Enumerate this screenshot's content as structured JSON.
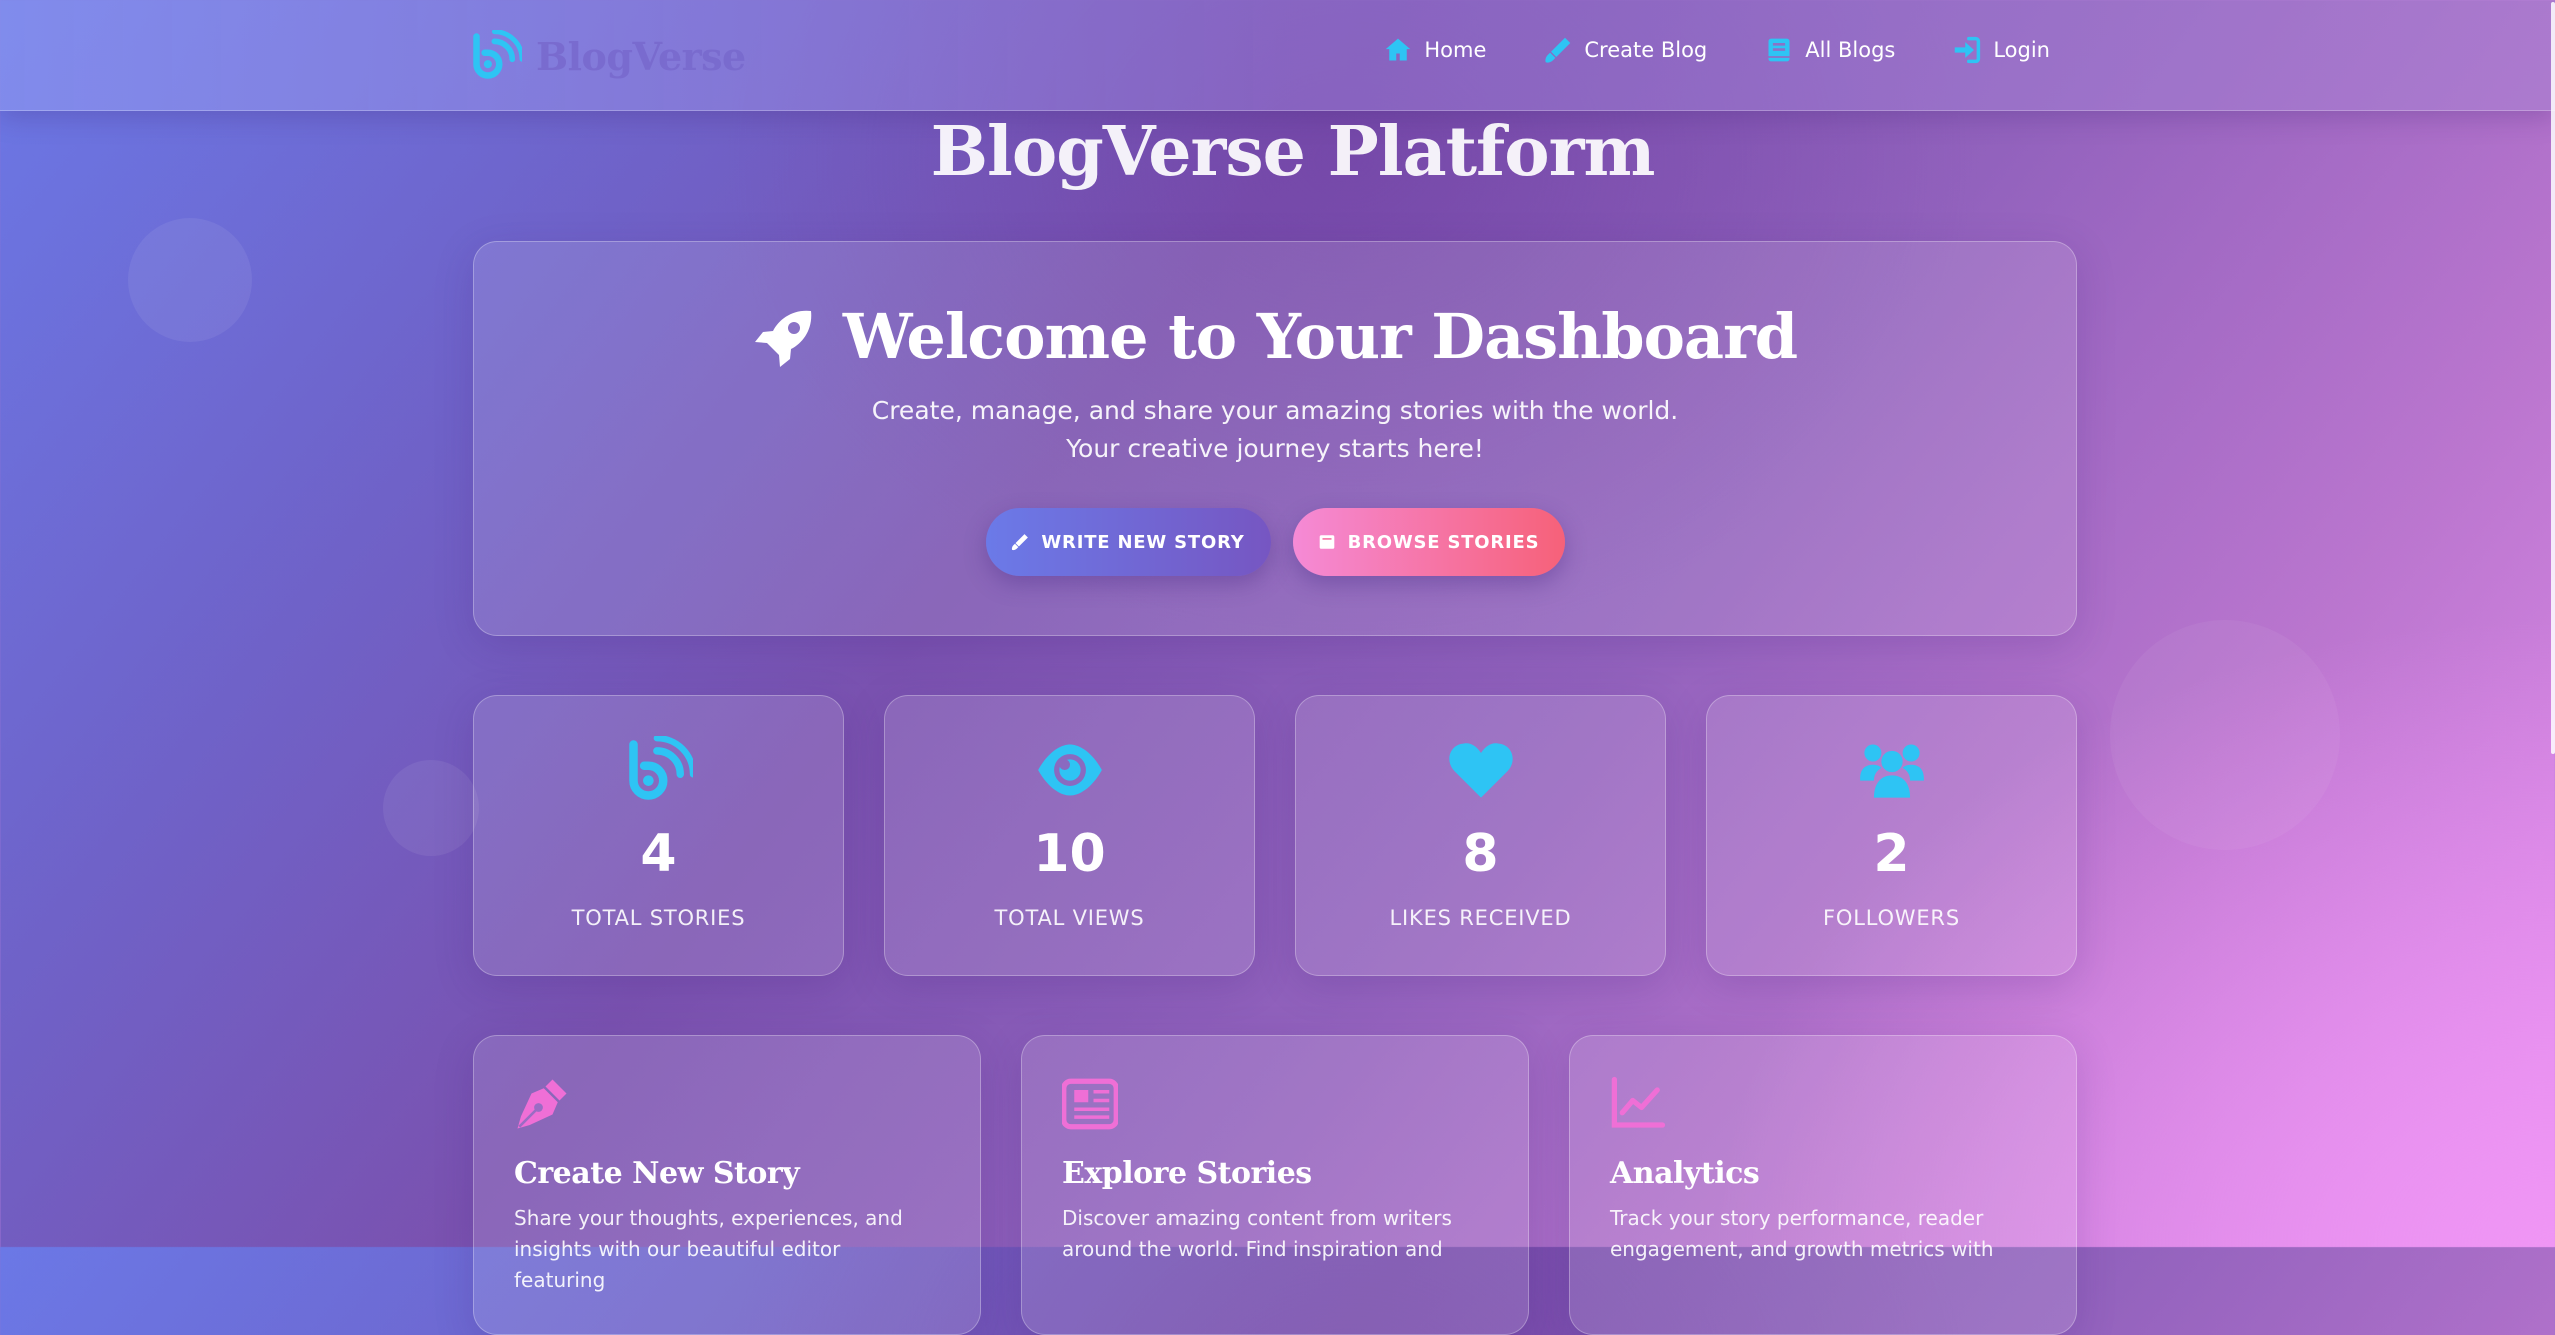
{
  "colors": {
    "icon_cyan": "#2ec4f4",
    "icon_pink": "#ef6fd6",
    "btn_primary": "#6b7ae8",
    "btn_secondary": "#f66179"
  },
  "navbar": {
    "brand": "BlogVerse",
    "brand_icon": "blog-icon",
    "links": [
      {
        "label": "Home",
        "icon": "home-icon"
      },
      {
        "label": "Create Blog",
        "icon": "pen-icon"
      },
      {
        "label": "All Blogs",
        "icon": "book-icon"
      },
      {
        "label": "Login",
        "icon": "login-icon"
      }
    ]
  },
  "page_title": "BlogVerse Platform",
  "hero": {
    "icon": "rocket-icon",
    "title": "Welcome to Your Dashboard",
    "subtitle_line1": "Create, manage, and share your amazing stories with the world.",
    "subtitle_line2": "Your creative journey starts here!",
    "primary_button": "WRITE NEW STORY",
    "secondary_button": "BROWSE STORIES"
  },
  "stats": [
    {
      "value": "4",
      "label": "TOTAL STORIES",
      "icon": "blog-icon"
    },
    {
      "value": "10",
      "label": "TOTAL VIEWS",
      "icon": "eye-icon"
    },
    {
      "value": "8",
      "label": "LIKES RECEIVED",
      "icon": "heart-icon"
    },
    {
      "value": "2",
      "label": "FOLLOWERS",
      "icon": "users-icon"
    }
  ],
  "features": [
    {
      "title": "Create New Story",
      "desc_line1": "Share your thoughts, experiences, and",
      "desc_line2": "insights with our beautiful editor featuring",
      "icon": "fountain-pen-icon"
    },
    {
      "title": "Explore Stories",
      "desc_line1": "Discover amazing content from writers",
      "desc_line2": "around the world. Find inspiration and",
      "icon": "newspaper-icon"
    },
    {
      "title": "Analytics",
      "desc_line1": "Track your story performance, reader",
      "desc_line2": "engagement, and growth metrics with",
      "icon": "chart-line-icon"
    }
  ]
}
